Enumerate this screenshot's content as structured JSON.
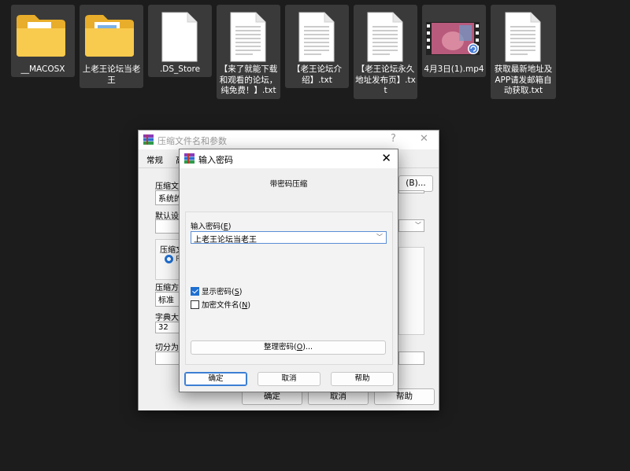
{
  "desktop": {
    "files": [
      {
        "name": "__MACOSX",
        "type": "folder",
        "icon": "folder-icon"
      },
      {
        "name": "上老王论坛当老王",
        "type": "folder",
        "icon": "folder-icon"
      },
      {
        "name": ".DS_Store",
        "type": "blank",
        "icon": "file-icon"
      },
      {
        "name": "【来了就能下载和观看的论坛，纯免费！】.txt",
        "type": "txt",
        "icon": "text-file-icon"
      },
      {
        "name": "【老王论坛介绍】.txt",
        "type": "txt",
        "icon": "text-file-icon"
      },
      {
        "name": "【老王论坛永久地址发布页】.txt",
        "type": "txt",
        "icon": "text-file-icon"
      },
      {
        "name": "4月3日(1).mp4",
        "type": "video",
        "icon": "video-file-icon"
      },
      {
        "name": "获取最新地址及APP请发邮箱自动获取.txt",
        "type": "txt",
        "icon": "text-file-icon"
      }
    ]
  },
  "archive_dialog": {
    "title": "压缩文件名和参数",
    "help_glyph": "?",
    "close_glyph": "✕",
    "tabs": [
      "常规",
      "高"
    ],
    "labels": {
      "archive_name": "压缩文件",
      "default_settings": "默认设置",
      "archive_format": "压缩文",
      "compression_method": "压缩方式",
      "dictionary_size": "字典大小",
      "split_volumes": "切分为分"
    },
    "values": {
      "archive_name_prefix": "系统的",
      "compression_method": "标准",
      "dictionary_size": "32",
      "format_radio": "R"
    },
    "browse_button": "(B)...",
    "ok_button": "确定",
    "cancel_button": "取消",
    "help_button": "帮助"
  },
  "password_dialog": {
    "title": "输入密码",
    "close_glyph": "✕",
    "heading": "带密码压缩",
    "password_label": {
      "text": "输入密码(",
      "key": "E",
      "suffix": ")"
    },
    "password_value": "上老王论坛当老王",
    "show_password": {
      "text": "显示密码(",
      "key": "S",
      "suffix": ")",
      "checked": true
    },
    "encrypt_names": {
      "text": "加密文件名(",
      "key": "N",
      "suffix": ")",
      "checked": false
    },
    "manage_button": {
      "text": "整理密码(",
      "key": "O",
      "suffix": ")..."
    },
    "ok_button": "确定",
    "cancel_button": "取消",
    "help_button": "帮助"
  },
  "colors": {
    "desktop_bg": "#1c1c1c",
    "folder_yellow": "#f5c645",
    "accent_blue": "#1f6fd1",
    "dialog_bg": "#f0f0f0"
  }
}
